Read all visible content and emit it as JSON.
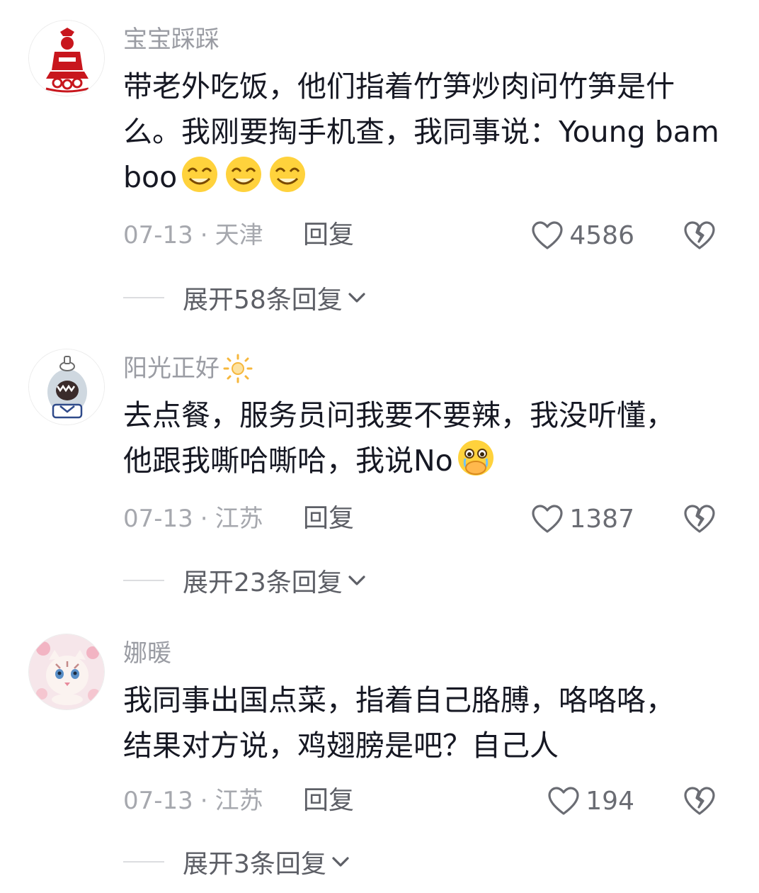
{
  "comments": [
    {
      "username": "宝宝踩踩",
      "text": "带老外吃饭，他们指着竹笋炒肉问竹笋是什么。我刚要掏手机查，我同事说：Young bamboo",
      "date": "07-13",
      "location": "天津",
      "reply_label": "回复",
      "likes": "4586",
      "expand_label": "展开58条回复",
      "emoji_icons": [
        "squinting-laugh-emoji",
        "squinting-laugh-emoji",
        "squinting-laugh-emoji"
      ]
    },
    {
      "username": "阳光正好",
      "text": "去点餐，服务员问我要不要辣，我没听懂，他跟我嘶哈嘶哈，我说No",
      "date": "07-13",
      "location": "江苏",
      "reply_label": "回复",
      "likes": "1387",
      "expand_label": "展开23条回复",
      "emoji_icons": [
        "crying-covering-mouth-emoji"
      ]
    },
    {
      "username": "娜暖",
      "text": "我同事出国点菜，指着自己胳膊，咯咯咯，结果对方说，鸡翅膀是吧？自己人",
      "date": "07-13",
      "location": "江苏",
      "reply_label": "回复",
      "likes": "194",
      "expand_label": "展开3条回复",
      "emoji_icons": []
    }
  ],
  "separator": "·",
  "colors": {
    "text_primary": "#161823",
    "text_secondary": "#9a9ca3",
    "avatar_red": "#c8161d",
    "emoji_yellow": "#ffd23c"
  }
}
